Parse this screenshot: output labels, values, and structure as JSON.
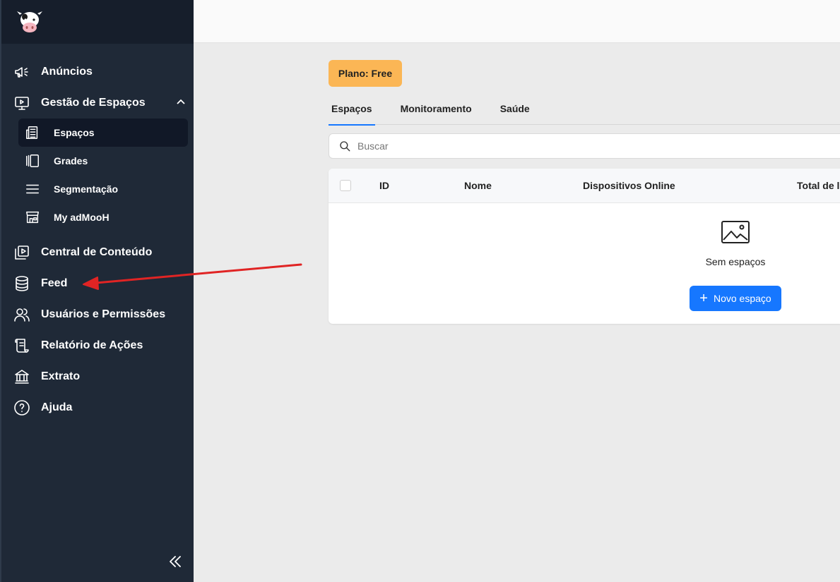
{
  "sidebar": {
    "items": [
      {
        "label": "Anúncios",
        "icon": "megaphone-icon"
      },
      {
        "label": "Gestão de Espaços",
        "icon": "monitor-play-icon"
      },
      {
        "label": "Central de Conteúdo",
        "icon": "content-library-icon"
      },
      {
        "label": "Feed",
        "icon": "database-icon"
      },
      {
        "label": "Usuários e Permissões",
        "icon": "users-icon"
      },
      {
        "label": "Relatório de Ações",
        "icon": "scroll-icon"
      },
      {
        "label": "Extrato",
        "icon": "bank-icon"
      },
      {
        "label": "Ajuda",
        "icon": "help-circle-icon"
      }
    ],
    "subitems": [
      {
        "label": "Espaços",
        "icon": "building-icon",
        "active": true
      },
      {
        "label": "Grades",
        "icon": "carousel-icon"
      },
      {
        "label": "Segmentação",
        "icon": "menu-lines-icon"
      },
      {
        "label": "My adMooH",
        "icon": "storefront-icon"
      }
    ]
  },
  "main": {
    "plan_badge": "Plano: Free",
    "tabs": [
      {
        "label": "Espaços",
        "active": true
      },
      {
        "label": "Monitoramento"
      },
      {
        "label": "Saúde"
      }
    ],
    "search": {
      "placeholder": "Buscar"
    },
    "table": {
      "columns": [
        "ID",
        "Nome",
        "Dispositivos Online",
        "Total de li"
      ],
      "empty_text": "Sem espaços",
      "new_button": "Novo espaço"
    }
  },
  "colors": {
    "sidebar_bg": "#1f2937",
    "accent": "#1677ff",
    "plan_badge": "#fbb655",
    "annotation_arrow": "#e02424"
  }
}
